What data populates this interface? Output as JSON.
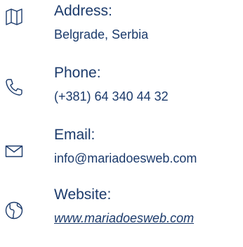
{
  "contacts": [
    {
      "icon": "map-icon",
      "label": "Address:",
      "value": "Belgrade, Serbia"
    },
    {
      "icon": "phone-icon",
      "label": "Phone:",
      "value": "(+381) 64 340 44 32"
    },
    {
      "icon": "envelope-icon",
      "label": "Email:",
      "value": "info@mariadoesweb.com"
    },
    {
      "icon": "globe-icon",
      "label": "Website:",
      "value": "www.mariadoesweb.com"
    }
  ],
  "colors": {
    "text": "#1b3a6b",
    "icon": "#1b3a6b",
    "background": "#ffffff"
  }
}
